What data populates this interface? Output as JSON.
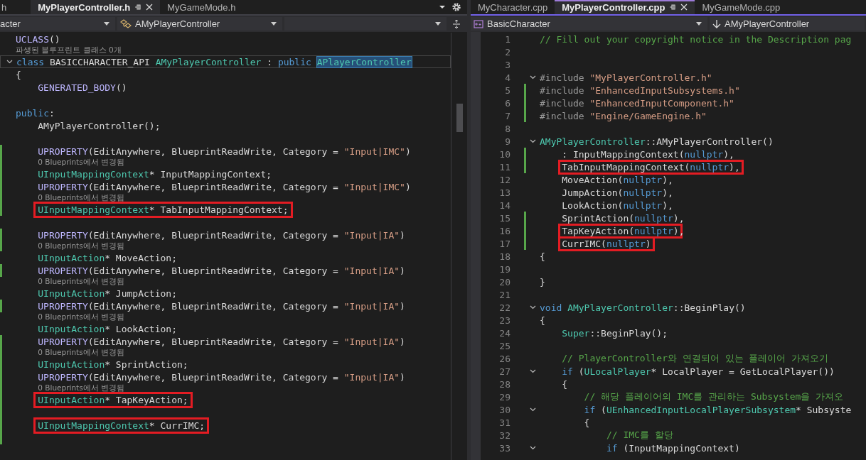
{
  "left_pane": {
    "focused": false,
    "tabs": [
      {
        "label": "h",
        "selected": false
      },
      {
        "label": "MyPlayerController.h",
        "selected": true
      },
      {
        "label": "MyGameMode.h",
        "selected": false
      }
    ],
    "nav": {
      "project": "acter",
      "scope": "AMyPlayerController"
    },
    "lines": [
      {
        "kind": "code",
        "changed": false,
        "foldable": false,
        "current": false,
        "tokens": [
          {
            "t": "UCLASS",
            "kind": "macro"
          },
          {
            "t": "()",
            "kind": "plain"
          }
        ]
      },
      {
        "kind": "hint",
        "changed": false,
        "foldable": false,
        "current": false,
        "text": "파생된 블루프린트 클래스 0개"
      },
      {
        "kind": "code",
        "changed": false,
        "foldable": true,
        "current": true,
        "tokens": [
          {
            "t": "class ",
            "kind": "kw"
          },
          {
            "t": "BASICCHARACTER_API ",
            "kind": "plain"
          },
          {
            "t": "AMyPlayerController",
            "kind": "type"
          },
          {
            "t": " : ",
            "kind": "plain"
          },
          {
            "t": "public ",
            "kind": "kw"
          },
          {
            "t": "APlayerController",
            "kind": "selection"
          }
        ]
      },
      {
        "kind": "code",
        "changed": false,
        "foldable": false,
        "current": false,
        "tokens": [
          {
            "t": "{",
            "kind": "plain"
          }
        ],
        "children": [
          {
            "kind": "code",
            "changed": false,
            "foldable": false,
            "current": false,
            "tokens": [
              {
                "t": "GENERATED_BODY",
                "kind": "macro"
              },
              {
                "t": "()",
                "kind": "plain"
              }
            ]
          }
        ]
      },
      {
        "kind": "code",
        "changed": false,
        "foldable": false,
        "current": false
      },
      {
        "kind": "code",
        "changed": false,
        "foldable": false,
        "current": false,
        "tokens": [
          {
            "t": "public",
            "kind": "kw"
          },
          {
            "t": ":",
            "kind": "plain"
          }
        ],
        "children": [
          {
            "kind": "code",
            "changed": false,
            "foldable": false,
            "current": false,
            "tokens": [
              {
                "t": "AMyPlayerController();",
                "kind": "plain"
              }
            ]
          },
          {
            "kind": "code",
            "changed": false,
            "foldable": false,
            "current": false
          },
          {
            "kind": "code",
            "changed": true,
            "foldable": false,
            "current": false,
            "tokens": [
              {
                "t": "UPROPERTY",
                "kind": "macro"
              },
              {
                "t": "(EditAnywhere, BlueprintReadWrite, Category = ",
                "kind": "plain"
              },
              {
                "t": "\"Input|IMC\"",
                "kind": "str"
              },
              {
                "t": ")",
                "kind": "plain"
              }
            ]
          },
          {
            "kind": "hint",
            "changed": true,
            "foldable": false,
            "current": false,
            "text": "0 Blueprints에서 변경됨"
          },
          {
            "kind": "code",
            "changed": true,
            "foldable": false,
            "current": false,
            "tokens": [
              {
                "t": "UInputMappingContext",
                "kind": "type"
              },
              {
                "t": "* InputMappingContext;",
                "kind": "plain"
              }
            ]
          },
          {
            "kind": "code",
            "changed": true,
            "foldable": false,
            "current": false,
            "tokens": [
              {
                "t": "UPROPERTY",
                "kind": "macro"
              },
              {
                "t": "(EditAnywhere, BlueprintReadWrite, Category = ",
                "kind": "plain"
              },
              {
                "t": "\"Input|IMC\"",
                "kind": "str"
              },
              {
                "t": ")",
                "kind": "plain"
              }
            ]
          },
          {
            "kind": "hint",
            "changed": true,
            "foldable": false,
            "current": false,
            "text": "0 Blueprints에서 변경됨"
          },
          {
            "kind": "code",
            "changed": true,
            "foldable": false,
            "current": false,
            "boxed": [
              {
                "t": "UInputMappingContext",
                "kind": "type"
              },
              {
                "t": "* TabInputMappingContext;",
                "kind": "plain"
              }
            ]
          },
          {
            "kind": "code",
            "changed": false,
            "foldable": false,
            "current": false
          },
          {
            "kind": "code",
            "changed": true,
            "foldable": false,
            "current": false,
            "tokens": [
              {
                "t": "UPROPERTY",
                "kind": "macro"
              },
              {
                "t": "(EditAnywhere, BlueprintReadWrite, Category = ",
                "kind": "plain"
              },
              {
                "t": "\"Input|IA\"",
                "kind": "str"
              },
              {
                "t": ")",
                "kind": "plain"
              }
            ]
          },
          {
            "kind": "hint",
            "changed": true,
            "foldable": false,
            "current": false,
            "text": "0 Blueprints에서 변경됨"
          },
          {
            "kind": "code",
            "changed": false,
            "foldable": false,
            "current": false,
            "tokens": [
              {
                "t": "UInputAction",
                "kind": "type"
              },
              {
                "t": "* MoveAction;",
                "kind": "plain"
              }
            ]
          },
          {
            "kind": "code",
            "changed": true,
            "foldable": false,
            "current": false,
            "tokens": [
              {
                "t": "UPROPERTY",
                "kind": "macro"
              },
              {
                "t": "(EditAnywhere, BlueprintReadWrite, Category = ",
                "kind": "plain"
              },
              {
                "t": "\"Input|IA\"",
                "kind": "str"
              },
              {
                "t": ")",
                "kind": "plain"
              }
            ]
          },
          {
            "kind": "hint",
            "changed": false,
            "foldable": false,
            "current": false,
            "text": "0 Blueprints에서 변경됨"
          },
          {
            "kind": "code",
            "changed": false,
            "foldable": false,
            "current": false,
            "tokens": [
              {
                "t": "UInputAction",
                "kind": "type"
              },
              {
                "t": "* JumpAction;",
                "kind": "plain"
              }
            ]
          },
          {
            "kind": "code",
            "changed": true,
            "foldable": false,
            "current": false,
            "tokens": [
              {
                "t": "UPROPERTY",
                "kind": "macro"
              },
              {
                "t": "(EditAnywhere, BlueprintReadWrite, Category = ",
                "kind": "plain"
              },
              {
                "t": "\"Input|IA\"",
                "kind": "str"
              },
              {
                "t": ")",
                "kind": "plain"
              }
            ]
          },
          {
            "kind": "hint",
            "changed": false,
            "foldable": false,
            "current": false,
            "text": "0 Blueprints에서 변경됨"
          },
          {
            "kind": "code",
            "changed": false,
            "foldable": false,
            "current": false,
            "tokens": [
              {
                "t": "UInputAction",
                "kind": "type"
              },
              {
                "t": "* LookAction;",
                "kind": "plain"
              }
            ]
          },
          {
            "kind": "code",
            "changed": true,
            "foldable": false,
            "current": false,
            "tokens": [
              {
                "t": "UPROPERTY",
                "kind": "macro"
              },
              {
                "t": "(EditAnywhere, BlueprintReadWrite, Category = ",
                "kind": "plain"
              },
              {
                "t": "\"Input|IA\"",
                "kind": "str"
              },
              {
                "t": ")",
                "kind": "plain"
              }
            ]
          },
          {
            "kind": "hint",
            "changed": true,
            "foldable": false,
            "current": false,
            "text": "0 Blueprints에서 변경됨"
          },
          {
            "kind": "code",
            "changed": true,
            "foldable": false,
            "current": false,
            "tokens": [
              {
                "t": "UInputAction",
                "kind": "type"
              },
              {
                "t": "* SprintAction;",
                "kind": "plain"
              }
            ]
          },
          {
            "kind": "code",
            "changed": true,
            "foldable": false,
            "current": false,
            "tokens": [
              {
                "t": "UPROPERTY",
                "kind": "macro"
              },
              {
                "t": "(EditAnywhere, BlueprintReadWrite, Category = ",
                "kind": "plain"
              },
              {
                "t": "\"Input|IA\"",
                "kind": "str"
              },
              {
                "t": ")",
                "kind": "plain"
              }
            ]
          },
          {
            "kind": "hint",
            "changed": true,
            "foldable": false,
            "current": false,
            "text": "0 Blueprints에서 변경됨"
          },
          {
            "kind": "code",
            "changed": true,
            "foldable": false,
            "current": false,
            "boxed": [
              {
                "t": "UInputAction",
                "kind": "type"
              },
              {
                "t": "* TapKeyAction;",
                "kind": "plain"
              }
            ]
          },
          {
            "kind": "code",
            "changed": true,
            "foldable": false,
            "current": false
          },
          {
            "kind": "code",
            "changed": true,
            "foldable": false,
            "current": false,
            "boxed": [
              {
                "t": "UInputMappingContext",
                "kind": "type"
              },
              {
                "t": "* CurrIMC;",
                "kind": "plain"
              }
            ]
          },
          {
            "kind": "code",
            "changed": true,
            "foldable": false,
            "current": false
          }
        ]
      }
    ]
  },
  "right_pane": {
    "focused": true,
    "tabs": [
      {
        "label": "MyCharacter.cpp",
        "selected": false
      },
      {
        "label": "MyPlayerController.cpp",
        "selected": true
      },
      {
        "label": "MyGameMode.cpp",
        "selected": false
      }
    ],
    "nav": {
      "project": "BasicCharacter",
      "scope": "AMyPlayerController"
    },
    "lines": [
      {
        "number": "1",
        "kind": "code",
        "changed": false,
        "foldable": false,
        "current": false,
        "tokens": [
          {
            "t": "// Fill out your copyright notice in the Description pag",
            "kind": "cmt"
          }
        ]
      },
      {
        "number": "2",
        "kind": "code",
        "changed": false,
        "foldable": false,
        "current": false
      },
      {
        "number": "3",
        "kind": "code",
        "changed": false,
        "foldable": false,
        "current": false
      },
      {
        "number": "4",
        "kind": "code",
        "changed": false,
        "foldable": true,
        "current": false,
        "tokens": [
          {
            "t": "#include ",
            "kind": "pre"
          },
          {
            "t": "\"MyPlayerController.h\"",
            "kind": "str"
          }
        ]
      },
      {
        "number": "5",
        "kind": "code",
        "changed": true,
        "foldable": false,
        "current": false,
        "tokens": [
          {
            "t": "#include ",
            "kind": "pre"
          },
          {
            "t": "\"EnhancedInputSubsystems.h\"",
            "kind": "str"
          }
        ]
      },
      {
        "number": "6",
        "kind": "code",
        "changed": true,
        "foldable": false,
        "current": false,
        "tokens": [
          {
            "t": "#include ",
            "kind": "pre"
          },
          {
            "t": "\"EnhancedInputComponent.h\"",
            "kind": "str"
          }
        ]
      },
      {
        "number": "7",
        "kind": "code",
        "changed": true,
        "foldable": false,
        "current": false,
        "tokens": [
          {
            "t": "#include ",
            "kind": "pre"
          },
          {
            "t": "\"Engine/GameEngine.h\"",
            "kind": "str"
          }
        ]
      },
      {
        "number": "8",
        "kind": "code",
        "changed": false,
        "foldable": false,
        "current": false
      },
      {
        "number": "9",
        "kind": "code",
        "changed": false,
        "foldable": true,
        "current": false,
        "tokens": [
          {
            "t": "AMyPlayerController",
            "kind": "type"
          },
          {
            "t": "::AMyPlayerController()",
            "kind": "plain"
          }
        ],
        "children": [
          {
            "number": "10",
            "kind": "code",
            "changed": true,
            "foldable": false,
            "current": false,
            "tokens": [
              {
                "t": ": InputMappingContext(",
                "kind": "plain"
              },
              {
                "t": "nullptr",
                "kind": "kw"
              },
              {
                "t": "),",
                "kind": "plain"
              }
            ]
          },
          {
            "number": "11",
            "kind": "code",
            "changed": true,
            "foldable": false,
            "current": false,
            "boxed": [
              {
                "t": "TabInputMappingContext(",
                "kind": "plain"
              },
              {
                "t": "nullptr",
                "kind": "kw"
              },
              {
                "t": "),",
                "kind": "plain"
              }
            ]
          },
          {
            "number": "12",
            "kind": "code",
            "changed": false,
            "foldable": false,
            "current": false,
            "tokens": [
              {
                "t": "MoveAction(",
                "kind": "plain"
              },
              {
                "t": "nullptr",
                "kind": "kw"
              },
              {
                "t": "),",
                "kind": "plain"
              }
            ]
          },
          {
            "number": "13",
            "kind": "code",
            "changed": false,
            "foldable": false,
            "current": false,
            "tokens": [
              {
                "t": "JumpAction(",
                "kind": "plain"
              },
              {
                "t": "nullptr",
                "kind": "kw"
              },
              {
                "t": "),",
                "kind": "plain"
              }
            ]
          },
          {
            "number": "14",
            "kind": "code",
            "changed": false,
            "foldable": false,
            "current": false,
            "tokens": [
              {
                "t": "LookAction(",
                "kind": "plain"
              },
              {
                "t": "nullptr",
                "kind": "kw"
              },
              {
                "t": "),",
                "kind": "plain"
              }
            ]
          },
          {
            "number": "15",
            "kind": "code",
            "changed": true,
            "foldable": false,
            "current": false,
            "tokens": [
              {
                "t": "SprintAction(",
                "kind": "plain"
              },
              {
                "t": "nullptr",
                "kind": "kw"
              },
              {
                "t": "),",
                "kind": "plain"
              }
            ]
          },
          {
            "number": "16",
            "kind": "code",
            "changed": true,
            "foldable": false,
            "current": false,
            "boxed": [
              {
                "t": "TapKeyAction(",
                "kind": "plain"
              },
              {
                "t": "nullptr",
                "kind": "kw"
              },
              {
                "t": ")",
                "kind": "plain"
              }
            ],
            "after": [
              {
                "t": ",",
                "kind": "plain"
              }
            ]
          },
          {
            "number": "17",
            "kind": "code",
            "changed": true,
            "foldable": false,
            "current": false,
            "boxed": [
              {
                "t": "CurrIMC(",
                "kind": "plain"
              },
              {
                "t": "nullptr",
                "kind": "kw"
              },
              {
                "t": ")",
                "kind": "plain"
              }
            ]
          }
        ]
      },
      {
        "number": "18",
        "kind": "code",
        "changed": false,
        "foldable": false,
        "current": false,
        "tokens": [
          {
            "t": "{",
            "kind": "plain"
          }
        ]
      },
      {
        "number": "19",
        "kind": "code",
        "changed": false,
        "foldable": false,
        "current": false
      },
      {
        "number": "20",
        "kind": "code",
        "changed": false,
        "foldable": false,
        "current": false,
        "tokens": [
          {
            "t": "}",
            "kind": "plain"
          }
        ]
      },
      {
        "number": "21",
        "kind": "code",
        "changed": false,
        "foldable": false,
        "current": false
      },
      {
        "number": "22",
        "kind": "code",
        "changed": false,
        "foldable": true,
        "current": false,
        "tokens": [
          {
            "t": "void ",
            "kind": "kw"
          },
          {
            "t": "AMyPlayerController",
            "kind": "type"
          },
          {
            "t": "::BeginPlay()",
            "kind": "plain"
          }
        ]
      },
      {
        "number": "23",
        "kind": "code",
        "changed": false,
        "foldable": false,
        "current": false,
        "tokens": [
          {
            "t": "{",
            "kind": "plain"
          }
        ],
        "children": [
          {
            "number": "24",
            "kind": "code",
            "changed": false,
            "foldable": false,
            "current": false,
            "tokens": [
              {
                "t": "Super",
                "kind": "type"
              },
              {
                "t": "::BeginPlay();",
                "kind": "plain"
              }
            ]
          },
          {
            "number": "25",
            "kind": "code",
            "changed": false,
            "foldable": false,
            "current": false
          },
          {
            "number": "26",
            "kind": "code",
            "changed": false,
            "foldable": false,
            "current": false,
            "tokens": [
              {
                "t": "// PlayerController와 연결되어 있는 플레이어 가져오기",
                "kind": "cmt"
              }
            ]
          },
          {
            "number": "27",
            "kind": "code",
            "changed": false,
            "foldable": true,
            "current": false,
            "tokens": [
              {
                "t": "if ",
                "kind": "kw"
              },
              {
                "t": "(",
                "kind": "plain"
              },
              {
                "t": "ULocalPlayer",
                "kind": "type"
              },
              {
                "t": "* LocalPlayer = GetLocalPlayer())",
                "kind": "plain"
              }
            ]
          },
          {
            "number": "28",
            "kind": "code",
            "changed": false,
            "foldable": false,
            "current": false,
            "tokens": [
              {
                "t": "{",
                "kind": "plain"
              }
            ],
            "children": [
              {
                "number": "29",
                "kind": "code",
                "changed": false,
                "foldable": false,
                "current": false,
                "tokens": [
                  {
                    "t": "// 해당 플레이어의 IMC를 관리하는 Subsystem을 가져오",
                    "kind": "cmt"
                  }
                ]
              },
              {
                "number": "30",
                "kind": "code",
                "changed": false,
                "foldable": true,
                "current": false,
                "tokens": [
                  {
                    "t": "if ",
                    "kind": "kw"
                  },
                  {
                    "t": "(",
                    "kind": "plain"
                  },
                  {
                    "t": "UEnhancedInputLocalPlayerSubsystem",
                    "kind": "type"
                  },
                  {
                    "t": "* Subsyste",
                    "kind": "plain"
                  }
                ]
              },
              {
                "number": "31",
                "kind": "code",
                "changed": false,
                "foldable": false,
                "current": false,
                "tokens": [
                  {
                    "t": "{",
                    "kind": "plain"
                  }
                ],
                "children": [
                  {
                    "number": "32",
                    "kind": "code",
                    "changed": false,
                    "foldable": false,
                    "current": false,
                    "tokens": [
                      {
                        "t": "// IMC를 할당",
                        "kind": "cmt"
                      }
                    ]
                  },
                  {
                    "number": "33",
                    "kind": "code",
                    "changed": false,
                    "foldable": true,
                    "current": false,
                    "tokens": [
                      {
                        "t": "if ",
                        "kind": "kw"
                      },
                      {
                        "t": "(InputMappingContext)",
                        "kind": "plain"
                      }
                    ]
                  }
                ]
              }
            ]
          }
        ]
      }
    ]
  }
}
